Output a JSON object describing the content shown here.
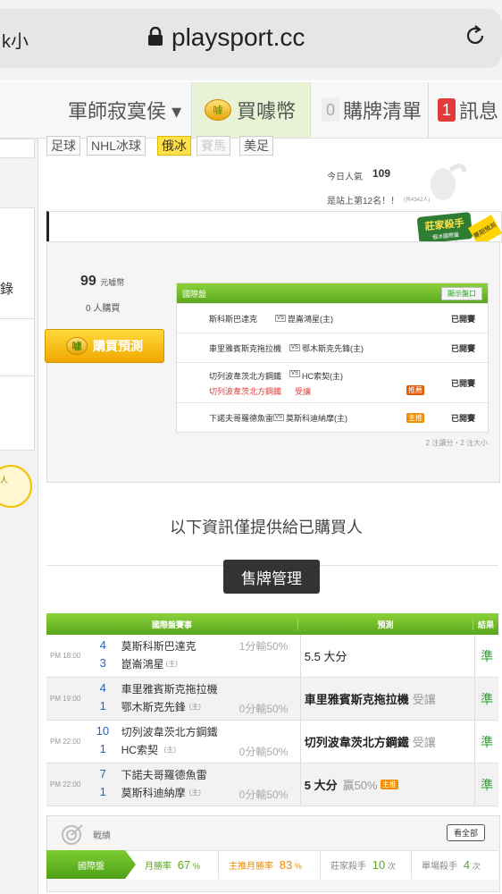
{
  "browser": {
    "left_fragment": "k小",
    "url": "playsport.cc"
  },
  "nav": {
    "user": "軍師寂寞侯 ▾",
    "buy_coin": "買噱幣",
    "cart_count": "0",
    "cart_label": "購牌清單",
    "msg_count": "1",
    "msg_label": "訊息",
    "coin_glyph": "噱"
  },
  "left": {
    "item1": "錄",
    "item2": "人"
  },
  "sport_tabs": [
    "足球",
    "NHL冰球",
    "俄冰",
    "賽馬",
    "美足"
  ],
  "popularity": {
    "label": "今日人氣",
    "value": "109",
    "rank": "是站上第12名！！",
    "rank_sub": "(共4342人)"
  },
  "badge": {
    "main": "莊家殺手",
    "sub": "俄冰國際盤",
    "corner": "賽期預測"
  },
  "price": {
    "amount": "99",
    "unit": "元噱幣",
    "buyers": "0 人購買",
    "buy_button": "購買預測"
  },
  "inner_table": {
    "header": "國際盤",
    "show_button": "顯示盤口",
    "rows": [
      {
        "home": "斯科斯巴達克",
        "away": "崑崙鴻星(主)",
        "status": "已開賽"
      },
      {
        "home": "車里雅賓斯克拖拉機",
        "away": "鄂木斯克先鋒(主)",
        "status": "已開賽"
      },
      {
        "home": "切列波韋茨北方鋼鐵",
        "away": "HC索契(主)",
        "pick_team": "切列波韋茨北方鋼鐵",
        "pick_type": "受讓",
        "tag": "推薦",
        "status": "已開賽"
      },
      {
        "home": "下諾夫哥羅德魚雷",
        "away": "莫斯科迪納摩(主)",
        "tag": "主推",
        "status": "已開賽"
      }
    ],
    "footer": "2 注讓分・2 注大小"
  },
  "info_note": "以下資訊僅提供給已購買人",
  "sell_button": "售牌管理",
  "main_table": {
    "headers": {
      "game": "國際盤賽事",
      "pred": "預測",
      "result": "結果"
    },
    "rows": [
      {
        "time": "PM 18:00",
        "n1": "4",
        "t1": "莫斯科斯巴達克",
        "n2": "3",
        "t2": "崑崙鴻星",
        "t2_tag": "(主)",
        "line": "1分輸50%",
        "pred": "5.5 大分",
        "pred_note": "",
        "pred_tag": "",
        "result": "準"
      },
      {
        "time": "PM 19:00",
        "n1": "4",
        "t1": "車里雅賓斯克拖拉機",
        "n2": "1",
        "t2": "鄂木斯克先鋒",
        "t2_tag": "(主)",
        "line": "0分輸50%",
        "pred": "車里雅賓斯克拖拉機",
        "pred_note": "受讓",
        "pred_tag": "",
        "result": "準"
      },
      {
        "time": "PM 22:00",
        "n1": "10",
        "t1": "切列波韋茨北方鋼鐵",
        "n2": "1",
        "t2": "HC索契",
        "t2_tag": "(主)",
        "line": "0分輸50%",
        "pred": "切列波韋茨北方鋼鐵",
        "pred_note": "受讓",
        "pred_tag": "",
        "result": "準"
      },
      {
        "time": "PM 22:00",
        "n1": "7",
        "t1": "下諾夫哥羅德魚雷",
        "n2": "1",
        "t2": "莫斯科迪納摩",
        "t2_tag": "(主)",
        "line": "0分輸50%",
        "pred": "5 大分",
        "pred_note": "贏50%",
        "pred_tag": "主推",
        "result": "準"
      }
    ]
  },
  "stats": {
    "title": "戰績",
    "view_all": "看全部",
    "tab": "國際盤",
    "items": [
      {
        "label": "月勝率",
        "value": "67",
        "unit": "%"
      },
      {
        "label": "主推月勝率",
        "value": "83",
        "unit": "%"
      },
      {
        "label": "莊家殺手",
        "value": "10",
        "unit": "次"
      },
      {
        "label": "單場殺手",
        "value": "4",
        "unit": "次"
      }
    ]
  }
}
